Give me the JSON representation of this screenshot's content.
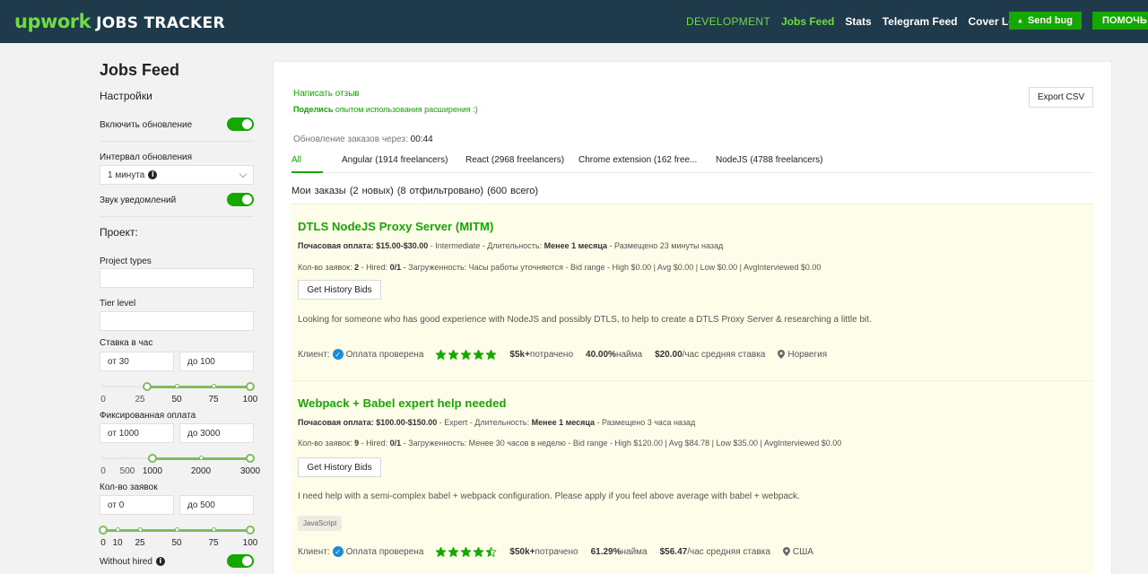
{
  "header": {
    "logo_up": "upwork",
    "logo_tracker": "JOBS TRACKER",
    "nav": {
      "development": "DEVELOPMENT",
      "jobs_feed": "Jobs Feed",
      "stats": "Stats",
      "telegram_feed": "Telegram Feed",
      "cover_letter": "Cover Letter"
    },
    "send_bug": "Send bug",
    "help": "ПОМОЧЬ А"
  },
  "sidebar": {
    "title": "Jobs Feed",
    "settings_heading": "Настройки",
    "enable_update": {
      "label": "Включить обновление",
      "on": true
    },
    "interval": {
      "label": "Интервал обновления",
      "value": "1 минута"
    },
    "sound": {
      "label": "Звук уведомлений",
      "on": true
    },
    "project_heading": "Проект:",
    "project_types": {
      "label": "Project types",
      "value": ""
    },
    "tier_level": {
      "label": "Tier level",
      "value": ""
    },
    "hourly_rate": {
      "label": "Ставка в час",
      "from": "от 30",
      "to": "до 100",
      "ticks": [
        "0",
        "25",
        "50",
        "75",
        "100"
      ],
      "range": [
        30,
        100
      ]
    },
    "fixed_price": {
      "label": "Фиксированная оплата",
      "from": "от 1000",
      "to": "до 3000",
      "ticks": [
        "0",
        "500",
        "1000",
        "2000",
        "3000"
      ],
      "range": [
        1000,
        3000
      ]
    },
    "proposals": {
      "label": "Кол-во заявок",
      "from": "от 0",
      "to": "до 500",
      "ticks": [
        "0",
        "10",
        "25",
        "50",
        "75",
        "100"
      ],
      "range": [
        0,
        100
      ]
    },
    "without_hired": {
      "label": "Without hired",
      "on": true
    }
  },
  "main": {
    "review_link": "Написать отзыв",
    "share_bold": "Поделись",
    "share_rest": " опытом использования расширения :)",
    "export_csv": "Export CSV",
    "update_label": "Обновление заказов через: ",
    "update_timer": "00:44",
    "tabs": [
      {
        "label": "All",
        "active": true
      },
      {
        "label": "Angular (1914 freelancers)"
      },
      {
        "label": "React (2968 freelancers)"
      },
      {
        "label": "Chrome extension (162 free..."
      },
      {
        "label": "NodeJS (4788 freelancers)"
      }
    ],
    "orders_summary": "Мои заказы (2 новых) (8 отфильтровано) (600 всего)",
    "jobs": [
      {
        "title": "DTLS NodeJS Proxy Server (MITM)",
        "pay_label": "Почасовая оплата: $15.00-$30.00",
        "pay_rest": " - Intermediate - Длительность: ",
        "duration": "Менее 1 месяца",
        "posted": " - Размещено 23 минуты назад",
        "proposals_label": "Кол-во заявок: ",
        "proposals": "2",
        "hired_label": " - Hired: ",
        "hired": "0/1",
        "details": " - Загруженность: Часы работы уточняются - Bid range - High $0.00 | Avg $0.00 | Low $0.00 | AvgInterviewed $0.00",
        "history_button": "Get History Bids",
        "description": "Looking for someone who has good experience with NodeJS and possibly DTLS, to help to create a DTLS Proxy Server & researching a little bit.",
        "tag": "",
        "client_label": "Клиент:",
        "verified": "Оплата проверена",
        "rating": 5,
        "spent": "$5k+",
        "spent_label": " потрачено",
        "hire_rate": "40.00%",
        "hire_label": " найма",
        "avg_rate": "$20.00",
        "avg_label": "/час средняя ставка",
        "country": "Норвегия"
      },
      {
        "title": "Webpack + Babel expert help needed",
        "pay_label": "Почасовая оплата: $100.00-$150.00",
        "pay_rest": " - Expert - Длительность: ",
        "duration": "Менее 1 месяца",
        "posted": " - Размещено 3 часа назад",
        "proposals_label": "Кол-во заявок: ",
        "proposals": "9",
        "hired_label": " - Hired: ",
        "hired": "0/1",
        "details": " - Загруженность: Менее 30 часов в неделю - Bid range - High $120.00 | Avg $84.78 | Low $35.00 | AvgInterviewed $0.00",
        "history_button": "Get History Bids",
        "description": "I need help with a semi-complex babel + webpack configuration. Please apply if you feel above average with babel + webpack.",
        "tag": "JavaScript",
        "client_label": "Клиент:",
        "verified": "Оплата проверена",
        "rating": 4.5,
        "spent": "$50k+",
        "spent_label": " потрачено",
        "hire_rate": "61.29%",
        "hire_label": " найма",
        "avg_rate": "$56.47",
        "avg_label": "/час средняя ставка",
        "country": "США"
      }
    ]
  },
  "colors": {
    "header_bg": "#1e3a4b",
    "accent_green": "#14a800",
    "logo_green": "#6fda44",
    "job_bg": "#fdfde9",
    "verified_blue": "#1a8cd8"
  }
}
